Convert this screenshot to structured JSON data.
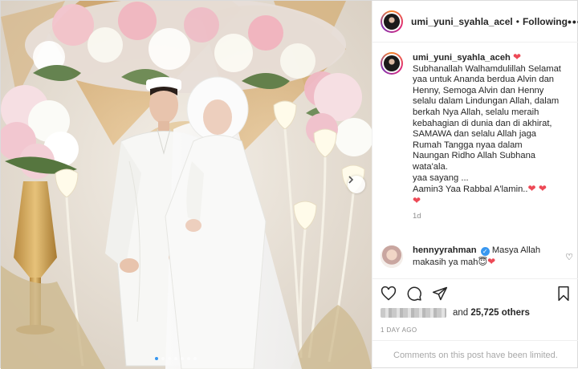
{
  "header": {
    "username": "umi_yuni_syahla_acel",
    "separator": "•",
    "follow_label": "Following",
    "more_label": "•••"
  },
  "caption": {
    "username": "umi_yuni_syahla_aceh",
    "heart": "❤",
    "verified_mark": "✓",
    "lines": [
      "Subhanallah Walhamdulillah Selamat",
      "yaa untuk Ananda berdua Alvin dan",
      "Henny, Semoga Alvin dan Henny",
      "selalu dalam Lindungan Allah, dalam",
      "berkah Nya Allah, selalu meraih",
      "kebahagian di dunia dan di akhirat,",
      "SAMAWA dan selalu Allah jaga",
      "Rumah Tangga nyaa dalam",
      "Naungan Ridho Allah Subhana",
      "wata'ala.",
      "yaa sayang ...",
      "Aamin3 Yaa Rabbal A'lamin.."
    ],
    "end_hearts": "❤ ❤",
    "last_heart": "❤",
    "time": "1d"
  },
  "reply": {
    "username": "hennyyrahman",
    "text_line1": "Masya Allah",
    "text_line2": "makasih ya mah",
    "emoji": "😇",
    "heart": "❤",
    "like_icon": "♡"
  },
  "likes": {
    "prefix": "and",
    "count": "25,725 others"
  },
  "post_age": "1 DAY AGO",
  "comments_limited": "Comments on this post have been limited.",
  "carousel": {
    "slides": 7,
    "active_index": 0,
    "next_icon": "chevron-right-icon"
  },
  "colors": {
    "accent": "#3897f0",
    "heart": "#ed4956",
    "muted": "#8e8e8e"
  }
}
